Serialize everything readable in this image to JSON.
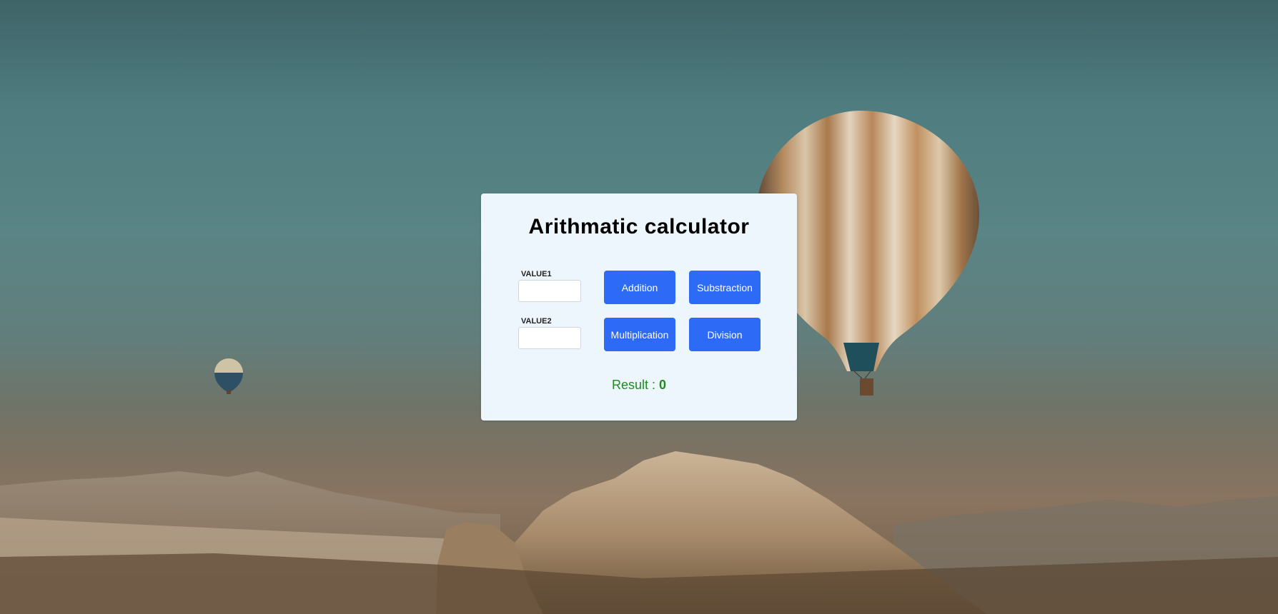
{
  "calculator": {
    "title": "Arithmatic calculator",
    "value1_label": "VALUE1",
    "value2_label": "VALUE2",
    "value1": "",
    "value2": "",
    "buttons": {
      "addition": "Addition",
      "subtraction": "Substraction",
      "multiplication": "Multiplication",
      "division": "Division"
    },
    "result_label": "Result : ",
    "result_value": "0"
  },
  "colors": {
    "button": "#2d6bf7",
    "card": "#eef6fd",
    "result": "#1f8a1f"
  }
}
